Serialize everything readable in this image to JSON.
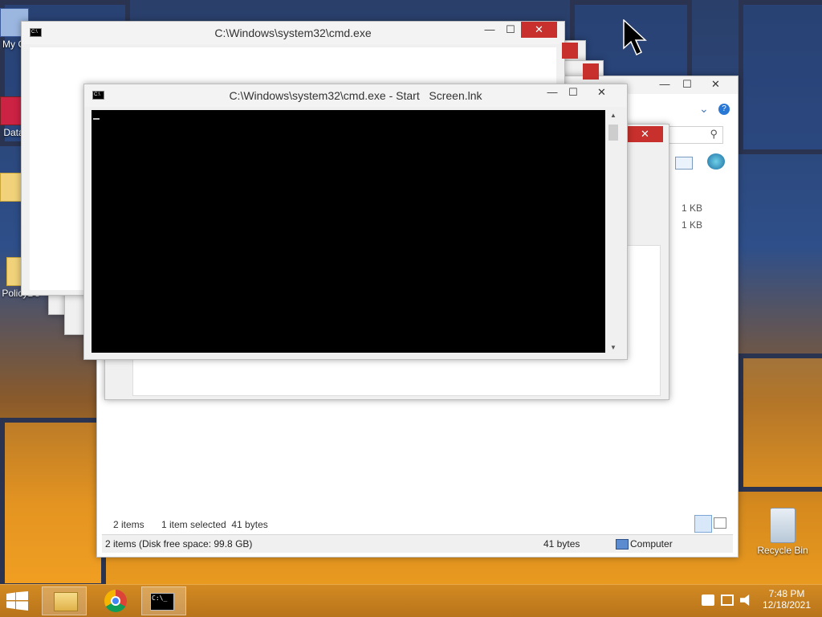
{
  "desktop": {
    "icons": [
      {
        "label": "My C",
        "name": "my-computer"
      },
      {
        "label": "Data",
        "name": "data"
      },
      {
        "label": "PolicyDe",
        "name": "policy"
      }
    ],
    "recycle_bin": "Recycle Bin"
  },
  "cmd_back": {
    "title": "C:\\Windows\\system32\\cmd.exe"
  },
  "cmd_front": {
    "title": "C:\\Windows\\system32\\cmd.exe - Start   Screen.lnk"
  },
  "explorer": {
    "sizes": [
      "1 KB",
      "1 KB"
    ],
    "status_items": "2 items",
    "status_selected": "1 item selected  41 bytes",
    "bottom_items": "2 items (Disk free space: 99.8 GB)",
    "bottom_size": "41 bytes",
    "bottom_location": "Computer"
  },
  "taskbar": {
    "time": "7:48 PM",
    "date": "12/18/2021"
  },
  "controls": {
    "minimize": "—",
    "maximize": "☐",
    "close": "✕",
    "scroll_up": "▲",
    "scroll_down": "▼",
    "search": "⚲",
    "help": "?",
    "chevron": "⌄"
  }
}
